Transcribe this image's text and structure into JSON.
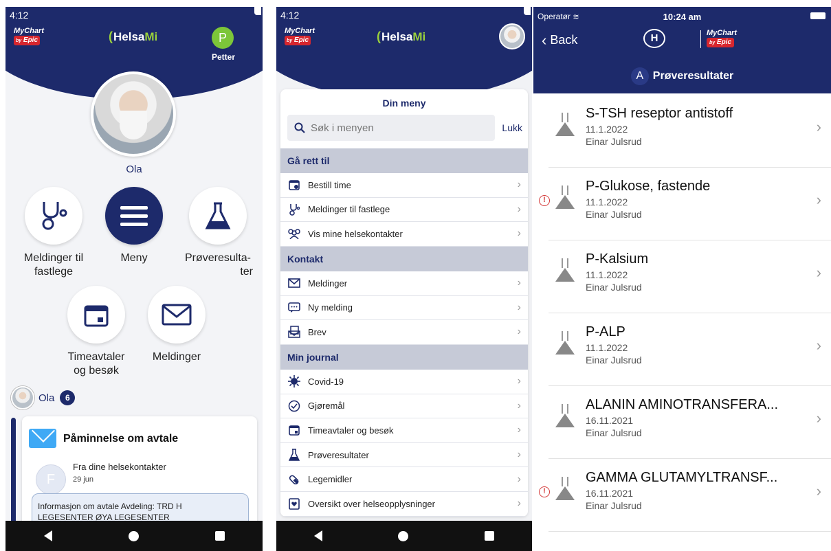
{
  "screen1": {
    "time": "4:12",
    "logo_mychart": "MyChart",
    "logo_epic": "Epic",
    "logo_by": "by",
    "brand_helsa": "Helsa",
    "brand_mi": "Mi",
    "user_initial": "P",
    "user_name": "Petter",
    "profile_name": "Ola",
    "tiles": {
      "messages_gp": "Meldinger til fastlege",
      "menu": "Meny",
      "test_results_line1": "Prøveresulta-",
      "test_results_line2": "ter",
      "appointments_line1": "Timeavtaler",
      "appointments_line2": "og besøk",
      "messages": "Meldinger"
    },
    "owner_name": "Ola",
    "owner_count": "6",
    "feed": {
      "title": "Påminnelse om avtale",
      "from_initial": "F",
      "from": "Fra dine helsekontakter",
      "date": "29 jun",
      "body_line1": "Informasjon om avtale  Avdeling: TRD H",
      "body_line2": "LEGESENTER ØYA LEGESENTER"
    }
  },
  "screen2": {
    "time": "4:12",
    "logo_mychart": "MyChart",
    "logo_epic": "Epic",
    "logo_by": "by",
    "brand_helsa": "Helsa",
    "brand_mi": "Mi",
    "menu_title": "Din meny",
    "search_placeholder": "Søk i menyen",
    "close_label": "Lukk",
    "sections": {
      "goto": "Gå rett til",
      "contact": "Kontakt",
      "journal": "Min journal"
    },
    "items": {
      "book": "Bestill time",
      "messages_gp": "Meldinger til fastlege",
      "contacts": "Vis mine helsekontakter",
      "messages": "Meldinger",
      "new_message": "Ny melding",
      "letter": "Brev",
      "covid": "Covid-19",
      "tasks": "Gjøremål",
      "appointments": "Timeavtaler og besøk",
      "results": "Prøveresultater",
      "medicines": "Legemidler",
      "overview": "Oversikt over helseopplysninger"
    }
  },
  "screen3": {
    "carrier": "Operatør",
    "time": "10:24 am",
    "back_label": "Back",
    "h_logo": "H",
    "logo_mychart": "MyChart",
    "logo_epic": "Epic",
    "logo_by": "by",
    "patient_initial": "A",
    "section_title": "Prøveresultater",
    "results": [
      {
        "title": "S-TSH reseptor antistoff",
        "date": "11.1.2022",
        "doctor": "Einar Julsrud",
        "alert": false
      },
      {
        "title": "P-Glukose, fastende",
        "date": "11.1.2022",
        "doctor": "Einar Julsrud",
        "alert": true
      },
      {
        "title": "P-Kalsium",
        "date": "11.1.2022",
        "doctor": "Einar Julsrud",
        "alert": false
      },
      {
        "title": "P-ALP",
        "date": "11.1.2022",
        "doctor": "Einar Julsrud",
        "alert": false
      },
      {
        "title": "ALANIN AMINOTRANSFERA...",
        "date": "16.11.2021",
        "doctor": "Einar Julsrud",
        "alert": false
      },
      {
        "title": "GAMMA GLUTAMYLTRANSF...",
        "date": "16.11.2021",
        "doctor": "Einar Julsrud",
        "alert": true
      }
    ],
    "alert_symbol": "!"
  },
  "colors": {
    "navy": "#1d2a6b",
    "brand_green": "#9bd23b",
    "epic_red": "#d7262e",
    "alert_red": "#d43b3b"
  }
}
